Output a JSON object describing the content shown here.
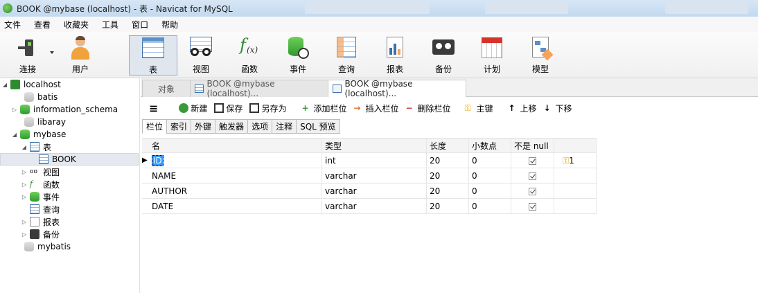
{
  "window": {
    "title": "BOOK @mybase (localhost) - 表 - Navicat for MySQL"
  },
  "menu": [
    "文件",
    "查看",
    "收藏夹",
    "工具",
    "窗口",
    "帮助"
  ],
  "toolbar": {
    "items": [
      {
        "label": "连接",
        "icon": "plug-icon"
      },
      {
        "label": "用户",
        "icon": "user-icon"
      },
      {
        "label": "表",
        "icon": "table-icon"
      },
      {
        "label": "视图",
        "icon": "glasses-icon"
      },
      {
        "label": "函数",
        "icon": "function-icon"
      },
      {
        "label": "事件",
        "icon": "event-icon"
      },
      {
        "label": "查询",
        "icon": "query-icon"
      },
      {
        "label": "报表",
        "icon": "report-icon"
      },
      {
        "label": "备份",
        "icon": "backup-icon"
      },
      {
        "label": "计划",
        "icon": "calendar-icon"
      },
      {
        "label": "模型",
        "icon": "model-icon"
      }
    ],
    "active": "表"
  },
  "tree": {
    "connection": "localhost",
    "databases": [
      "batis",
      "information_schema",
      "libaray",
      "mybase"
    ],
    "mybase_children": [
      "表",
      "视图",
      "函数",
      "事件",
      "查询",
      "报表",
      "备份"
    ],
    "table_child": "BOOK",
    "last_db": "mybatis"
  },
  "tabs": [
    {
      "label": "对象"
    },
    {
      "label": "BOOK @mybase (localhost)..."
    },
    {
      "label": "BOOK @mybase (localhost)..."
    }
  ],
  "objbar": {
    "new": "新建",
    "save": "保存",
    "saveas": "另存为",
    "add_field": "添加栏位",
    "insert_field": "插入栏位",
    "delete_field": "删除栏位",
    "primary_key": "主键",
    "move_up": "上移",
    "move_down": "下移"
  },
  "subtabs": [
    "栏位",
    "索引",
    "外键",
    "触发器",
    "选项",
    "注释",
    "SQL 预览"
  ],
  "grid": {
    "headers": [
      "名",
      "类型",
      "长度",
      "小数点",
      "不是 null",
      ""
    ],
    "rows": [
      {
        "name": "ID",
        "type": "int",
        "length": "20",
        "decimals": "0",
        "notnull": true,
        "key": "1"
      },
      {
        "name": "NAME",
        "type": "varchar",
        "length": "20",
        "decimals": "0",
        "notnull": true,
        "key": ""
      },
      {
        "name": "AUTHOR",
        "type": "varchar",
        "length": "20",
        "decimals": "0",
        "notnull": true,
        "key": ""
      },
      {
        "name": "DATE",
        "type": "varchar",
        "length": "20",
        "decimals": "0",
        "notnull": true,
        "key": ""
      }
    ]
  }
}
